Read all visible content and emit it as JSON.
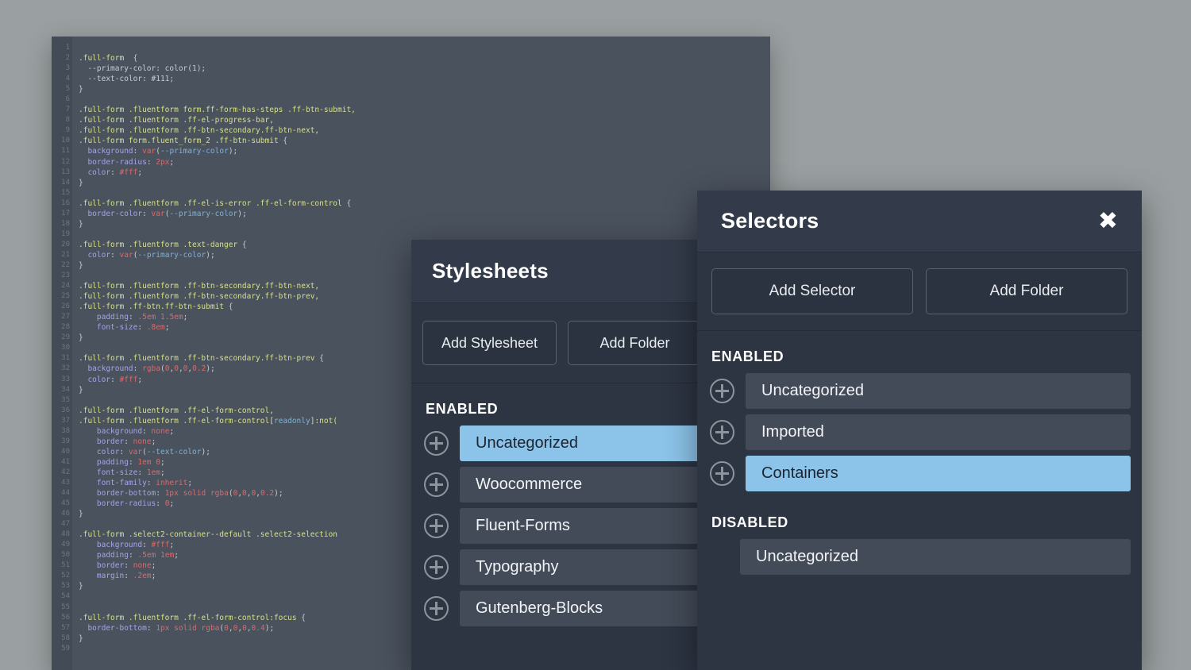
{
  "background_color": "#9aa0a1",
  "code_editor": {
    "name": "css-code-editor",
    "theme_background": "#4a525e",
    "gutter_background": "#434b56",
    "first_line_number": 1,
    "lines": [
      {
        "n": 1,
        "text": ""
      },
      {
        "n": 2,
        "text": ".full-form  {"
      },
      {
        "n": 3,
        "text": "  --primary-color: color(1);"
      },
      {
        "n": 4,
        "text": "  --text-color: #111;"
      },
      {
        "n": 5,
        "text": "}"
      },
      {
        "n": 6,
        "text": ""
      },
      {
        "n": 7,
        "text": ".full-form .fluentform form.ff-form-has-steps .ff-btn-submit,"
      },
      {
        "n": 8,
        "text": ".full-form .fluentform .ff-el-progress-bar,"
      },
      {
        "n": 9,
        "text": ".full-form .fluentform .ff-btn-secondary.ff-btn-next,"
      },
      {
        "n": 10,
        "text": ".full-form form.fluent_form_2 .ff-btn-submit {"
      },
      {
        "n": 11,
        "text": "  background: var(--primary-color);"
      },
      {
        "n": 12,
        "text": "  border-radius: 2px;"
      },
      {
        "n": 13,
        "text": "  color: #fff;"
      },
      {
        "n": 14,
        "text": "}"
      },
      {
        "n": 15,
        "text": ""
      },
      {
        "n": 16,
        "text": ".full-form .fluentform .ff-el-is-error .ff-el-form-control {"
      },
      {
        "n": 17,
        "text": "  border-color: var(--primary-color);"
      },
      {
        "n": 18,
        "text": "}"
      },
      {
        "n": 19,
        "text": ""
      },
      {
        "n": 20,
        "text": ".full-form .fluentform .text-danger {"
      },
      {
        "n": 21,
        "text": "  color: var(--primary-color);"
      },
      {
        "n": 22,
        "text": "}"
      },
      {
        "n": 23,
        "text": ""
      },
      {
        "n": 24,
        "text": ".full-form .fluentform .ff-btn-secondary.ff-btn-next,"
      },
      {
        "n": 25,
        "text": ".full-form .fluentform .ff-btn-secondary.ff-btn-prev,"
      },
      {
        "n": 26,
        "text": ".full-form .ff-btn.ff-btn-submit {"
      },
      {
        "n": 27,
        "text": "    padding: .5em 1.5em;"
      },
      {
        "n": 28,
        "text": "    font-size: .8em;"
      },
      {
        "n": 29,
        "text": "}"
      },
      {
        "n": 30,
        "text": ""
      },
      {
        "n": 31,
        "text": ".full-form .fluentform .ff-btn-secondary.ff-btn-prev {"
      },
      {
        "n": 32,
        "text": "  background: rgba(0,0,0,0.2);"
      },
      {
        "n": 33,
        "text": "  color: #fff;"
      },
      {
        "n": 34,
        "text": "}"
      },
      {
        "n": 35,
        "text": ""
      },
      {
        "n": 36,
        "text": ".full-form .fluentform .ff-el-form-control,"
      },
      {
        "n": 37,
        "text": ".full-form .fluentform .ff-el-form-control[readonly]:not("
      },
      {
        "n": 38,
        "text": "    background: none;"
      },
      {
        "n": 39,
        "text": "    border: none;"
      },
      {
        "n": 40,
        "text": "    color: var(--text-color);"
      },
      {
        "n": 41,
        "text": "    padding: 1em 0;"
      },
      {
        "n": 42,
        "text": "    font-size: 1em;"
      },
      {
        "n": 43,
        "text": "    font-family: inherit;"
      },
      {
        "n": 44,
        "text": "    border-bottom: 1px solid rgba(0,0,0,0.2);"
      },
      {
        "n": 45,
        "text": "    border-radius: 0;"
      },
      {
        "n": 46,
        "text": "}"
      },
      {
        "n": 47,
        "text": ""
      },
      {
        "n": 48,
        "text": ".full-form .select2-container--default .select2-selection"
      },
      {
        "n": 49,
        "text": "    background: #fff;"
      },
      {
        "n": 50,
        "text": "    padding: .5em 1em;"
      },
      {
        "n": 51,
        "text": "    border: none;"
      },
      {
        "n": 52,
        "text": "    margin: .2em;"
      },
      {
        "n": 53,
        "text": "}"
      },
      {
        "n": 54,
        "text": ""
      },
      {
        "n": 55,
        "text": ""
      },
      {
        "n": 56,
        "text": ".full-form .fluentform .ff-el-form-control:focus {"
      },
      {
        "n": 57,
        "text": "  border-bottom: 1px solid rgba(0,0,0,0.4);"
      },
      {
        "n": 58,
        "text": "}"
      },
      {
        "n": 59,
        "text": ""
      }
    ]
  },
  "stylesheets_panel": {
    "title": "Stylesheets",
    "actions": [
      {
        "label": "Add Stylesheet",
        "name": "add-stylesheet-button"
      },
      {
        "label": "Add Folder",
        "name": "add-folder-button"
      }
    ],
    "groups": [
      {
        "label": "ENABLED",
        "items": [
          {
            "label": "Uncategorized",
            "selected": true
          },
          {
            "label": "Woocommerce",
            "selected": false
          },
          {
            "label": "Fluent-Forms",
            "selected": false
          },
          {
            "label": "Typography",
            "selected": false
          },
          {
            "label": "Gutenberg-Blocks",
            "selected": false
          }
        ]
      }
    ]
  },
  "selectors_panel": {
    "title": "Selectors",
    "close_icon": "✖",
    "actions": [
      {
        "label": "Add Selector",
        "name": "add-selector-button"
      },
      {
        "label": "Add Folder",
        "name": "add-folder-button"
      }
    ],
    "groups": [
      {
        "label": "ENABLED",
        "items": [
          {
            "label": "Uncategorized",
            "selected": false,
            "has_plus": true
          },
          {
            "label": "Imported",
            "selected": false,
            "has_plus": true
          },
          {
            "label": "Containers",
            "selected": true,
            "has_plus": true
          }
        ]
      },
      {
        "label": "DISABLED",
        "items": [
          {
            "label": "Uncategorized",
            "selected": false,
            "has_plus": false
          }
        ]
      }
    ]
  },
  "colors": {
    "panel_background": "#2d3442",
    "panel_header": "#333b4a",
    "row_pill": "#434b58",
    "row_selected": "#8cc3e8",
    "accent_text": "#ffffff"
  }
}
